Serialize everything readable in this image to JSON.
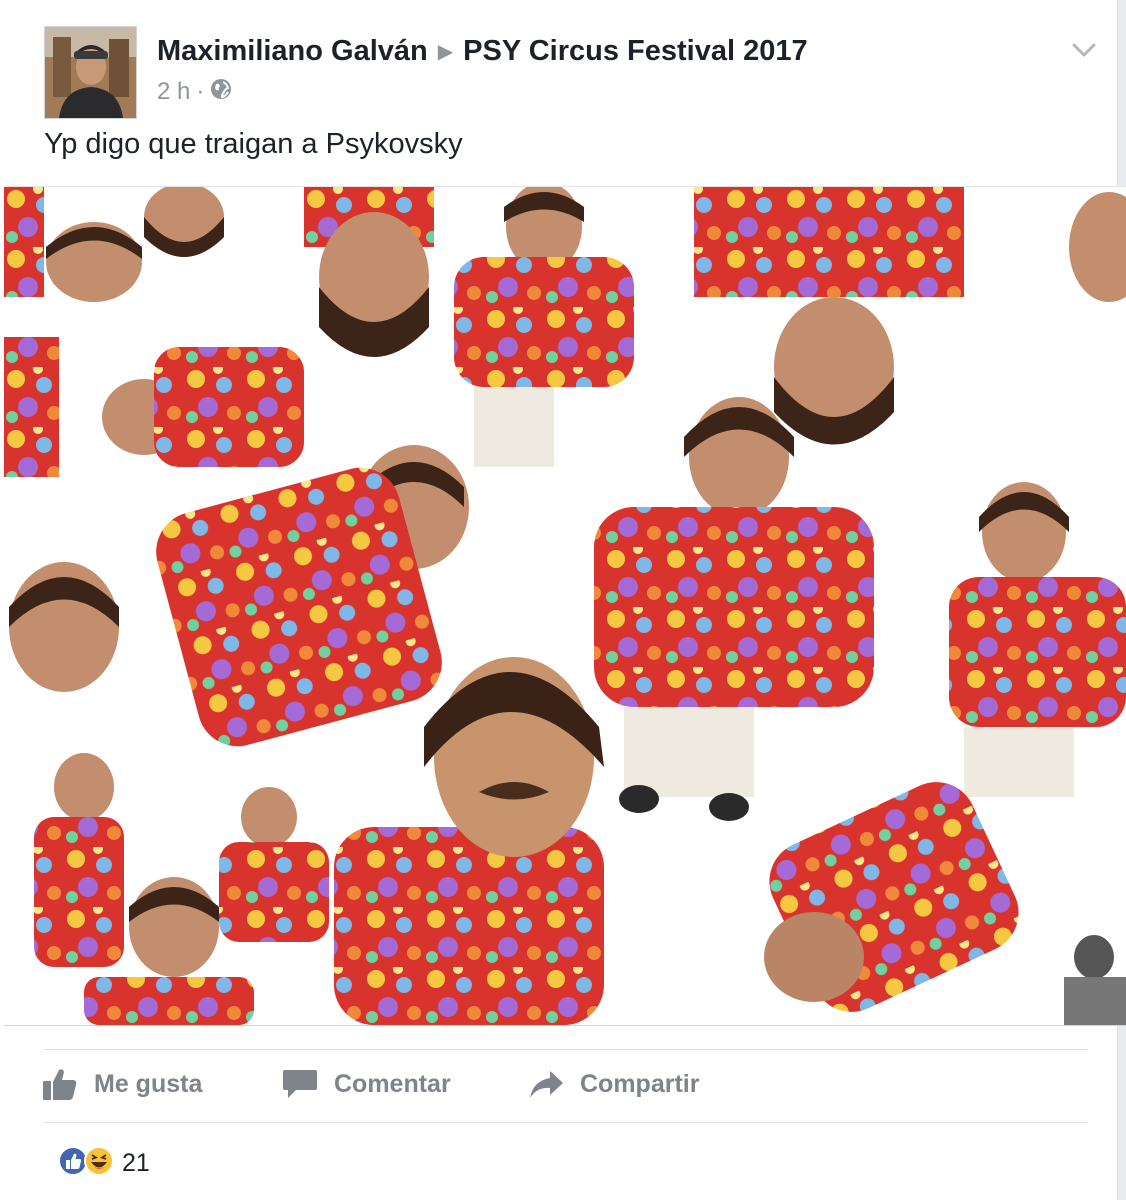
{
  "post": {
    "author": "Maximiliano Galván",
    "separator_icon": "triangle-right-icon",
    "target": "PSY Circus Festival 2017",
    "time": "2 h",
    "audience_icon": "globe-icon",
    "text": "Yp digo que traigan a Psykovsky"
  },
  "actions": {
    "like_label": "Me gusta",
    "comment_label": "Comentar",
    "share_label": "Compartir"
  },
  "reactions": {
    "types": [
      "like",
      "haha"
    ],
    "count": "21"
  },
  "colors": {
    "brand_blue": "#4267b2",
    "action_gray": "#7f838a",
    "meta_gray": "#90949c",
    "text": "#1d2129"
  }
}
